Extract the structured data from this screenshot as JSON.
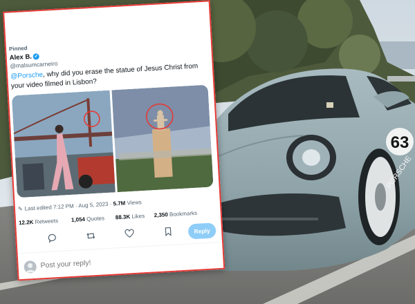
{
  "tweet": {
    "pinned_label": "Pinned",
    "author_name": "Alex B.",
    "author_handle": "@malsumcarneiro",
    "text_prefix": "",
    "mention": "@Porsche",
    "text_body": ", why did you erase the statue of Jesus Christ from your video filmed in Lisbon?",
    "edited_label": "Last edited 7:12 PM · Aug 5, 2023 ·",
    "views_count": "5.7M",
    "views_label": "Views"
  },
  "stats": {
    "retweets_count": "12.2K",
    "retweets_label": "Retweets",
    "quotes_count": "1,054",
    "quotes_label": "Quotes",
    "likes_count": "88.3K",
    "likes_label": "Likes",
    "bookmarks_count": "2,350",
    "bookmarks_label": "Bookmarks"
  },
  "actions": {
    "reply_button": "Reply",
    "compose_placeholder": "Post your reply!"
  },
  "icons": [
    "verified-badge-icon",
    "pencil-icon",
    "comment-icon",
    "retweet-icon",
    "like-icon",
    "bookmark-icon",
    "share-icon"
  ],
  "colors": {
    "accent": "#1d9bf0",
    "reply_button": "#8ecdf8",
    "annotation_red": "#e53935",
    "car_body": "#8fa4a9"
  },
  "background": {
    "car_number_1": "63",
    "car_wordmark": "PORSCHE"
  }
}
